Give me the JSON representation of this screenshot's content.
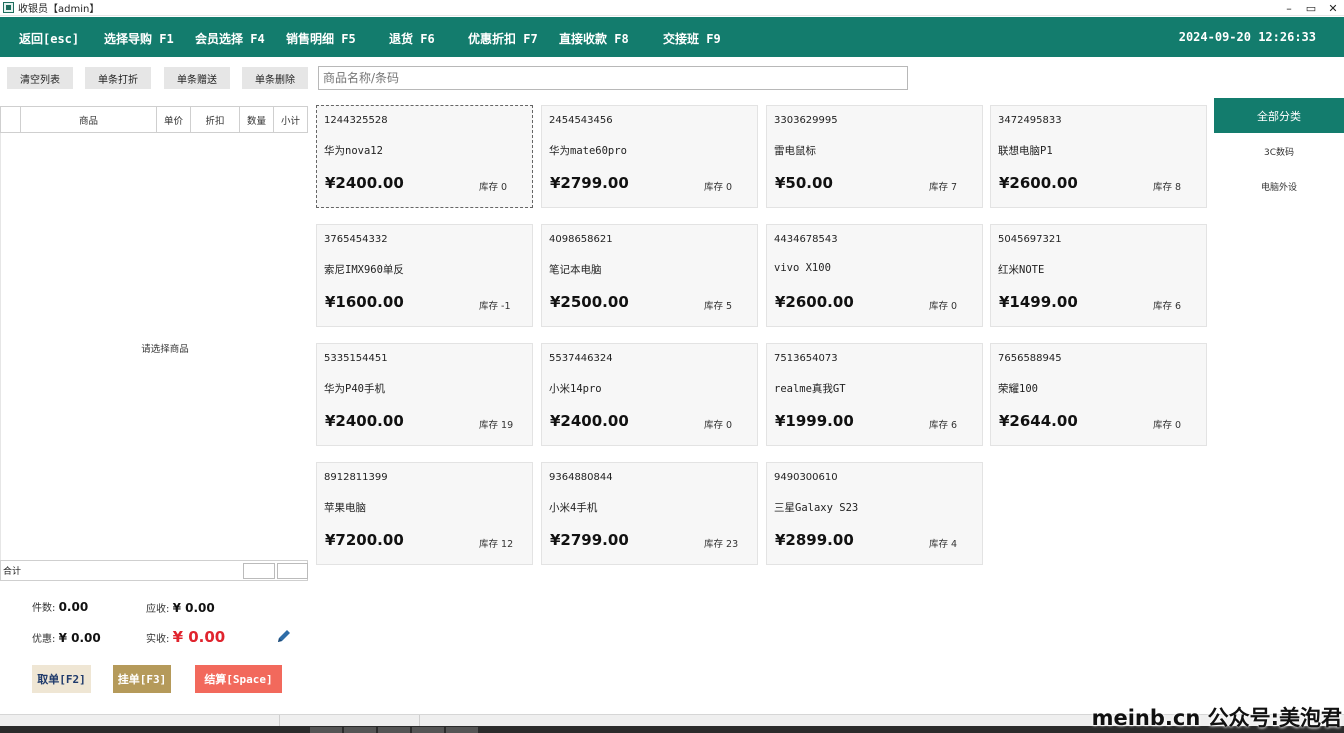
{
  "window": {
    "title": "收银员【admin】",
    "minimize": "–",
    "restore": "▭",
    "close": "✕"
  },
  "nav": {
    "items": [
      "返回[esc]",
      "选择导购 F1",
      "会员选择 F4",
      "销售明细 F5",
      "退货 F6",
      "优惠折扣 F7",
      "直接收款 F8",
      "交接班 F9"
    ],
    "clock": "2024-09-20 12:26:33"
  },
  "actions": [
    "清空列表",
    "单条打折",
    "单条赠送",
    "单条删除"
  ],
  "search": {
    "placeholder": "商品名称/条码"
  },
  "cart": {
    "columns": [
      "",
      "商品",
      "单价",
      "折扣",
      "数量",
      "小计"
    ],
    "empty_text": "请选择商品",
    "total_label": "合计"
  },
  "summary": {
    "count_label": "件数:",
    "count_value": "0.00",
    "due_label": "应收:",
    "due_value": "¥ 0.00",
    "discount_label": "优惠:",
    "discount_value": "¥ 0.00",
    "paid_label": "实收:",
    "paid_value": "¥ 0.00"
  },
  "buttons": {
    "retrieve": "取单[F2]",
    "hold": "挂单[F3]",
    "checkout": "结算[Space]"
  },
  "products": [
    {
      "code": "1244325528",
      "name": "华为nova12",
      "price": "¥2400.00",
      "stock": "库存 0"
    },
    {
      "code": "2454543456",
      "name": "华为mate60pro",
      "price": "¥2799.00",
      "stock": "库存 0"
    },
    {
      "code": "3303629995",
      "name": "雷电鼠标",
      "price": "¥50.00",
      "stock": "库存 7"
    },
    {
      "code": "3472495833",
      "name": "联想电脑P1",
      "price": "¥2600.00",
      "stock": "库存 8"
    },
    {
      "code": "3765454332",
      "name": "索尼IMX960单反",
      "price": "¥1600.00",
      "stock": "库存 -1"
    },
    {
      "code": "4098658621",
      "name": "笔记本电脑",
      "price": "¥2500.00",
      "stock": "库存 5"
    },
    {
      "code": "4434678543",
      "name": "vivo X100",
      "price": "¥2600.00",
      "stock": "库存 0"
    },
    {
      "code": "5045697321",
      "name": "红米NOTE",
      "price": "¥1499.00",
      "stock": "库存 6"
    },
    {
      "code": "5335154451",
      "name": "华为P40手机",
      "price": "¥2400.00",
      "stock": "库存 19"
    },
    {
      "code": "5537446324",
      "name": "小米14pro",
      "price": "¥2400.00",
      "stock": "库存 0"
    },
    {
      "code": "7513654073",
      "name": "realme真我GT",
      "price": "¥1999.00",
      "stock": "库存 6"
    },
    {
      "code": "7656588945",
      "name": "荣耀100",
      "price": "¥2644.00",
      "stock": "库存 0"
    },
    {
      "code": "8912811399",
      "name": "苹果电脑",
      "price": "¥7200.00",
      "stock": "库存 12"
    },
    {
      "code": "9364880844",
      "name": "小米4手机",
      "price": "¥2799.00",
      "stock": "库存 23"
    },
    {
      "code": "9490300610",
      "name": "三星Galaxy S23",
      "price": "¥2899.00",
      "stock": "库存 4"
    }
  ],
  "categories": [
    "全部分类",
    "3C数码",
    "电脑外设"
  ],
  "watermark": "meinb.cn 公众号:美泡君",
  "colors": {
    "accent": "#137c6d",
    "retrieve_bg": "#efe6d4",
    "hold_bg": "#b59a5a",
    "checkout_bg": "#f2695c",
    "paid_red": "#e0242e"
  }
}
